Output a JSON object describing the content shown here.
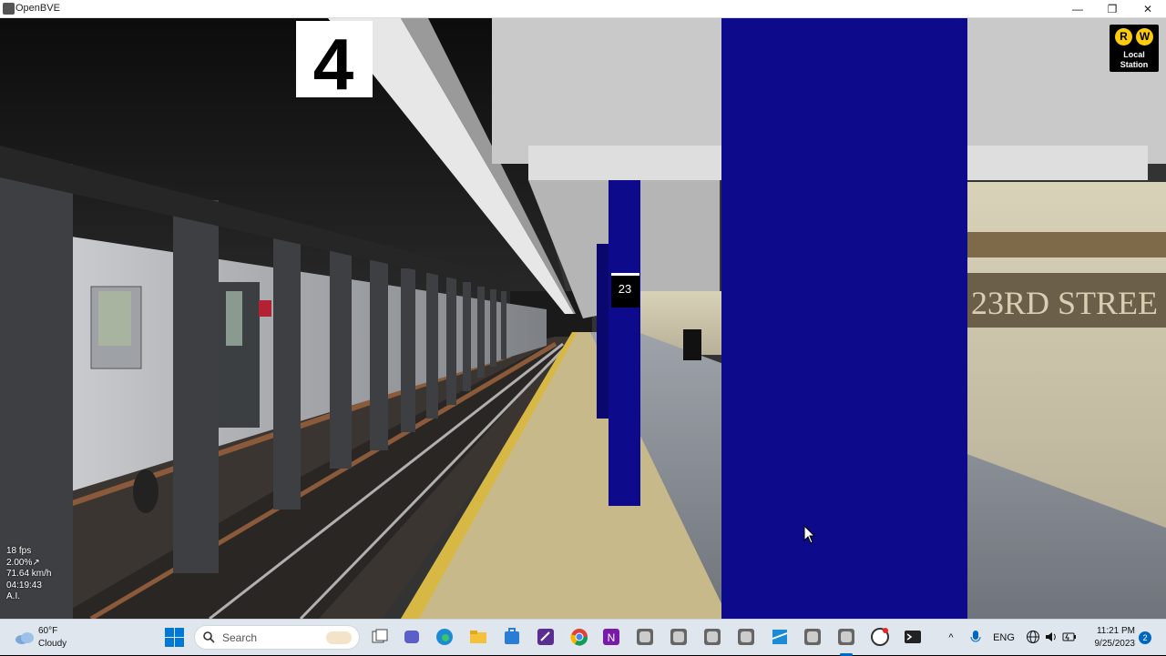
{
  "window": {
    "title": "OpenBVE",
    "minimize": "—",
    "maximize": "❐",
    "close": "✕"
  },
  "scene": {
    "track_sign": "4",
    "column_sign": "23",
    "wall_mosaic_text": "23RD STREE",
    "route_badge": {
      "bullets": [
        "R",
        "W"
      ],
      "line1": "Local",
      "line2": "Station",
      "bullet_color": "#fccc0a"
    },
    "column_color": "#0d0a8c"
  },
  "hud": {
    "fps": "18 fps",
    "grade": "2.00%↗",
    "speed": "71.64 km/h",
    "time": "04:19:43",
    "mode": "A.I."
  },
  "taskbar": {
    "weather": {
      "temp": "60°F",
      "condition": "Cloudy",
      "icon": "cloud-icon"
    },
    "search_placeholder": "Search",
    "apps": [
      "task-view-icon",
      "teams-icon",
      "edge-icon",
      "file-explorer-icon",
      "store-icon",
      "visual-studio-icon",
      "chrome-icon",
      "onenote-icon",
      "openbve-icon",
      "openbve-icon",
      "openbve-icon",
      "openbve-icon",
      "app-icon",
      "openbve-icon",
      "openbve-active-icon",
      "obs-icon",
      "terminal-icon"
    ],
    "tray": {
      "chevron": "^",
      "lang": "ENG"
    },
    "clock": {
      "time": "11:21 PM",
      "date": "9/25/2023"
    },
    "notifications": "2",
    "accent": "#0067c0"
  }
}
